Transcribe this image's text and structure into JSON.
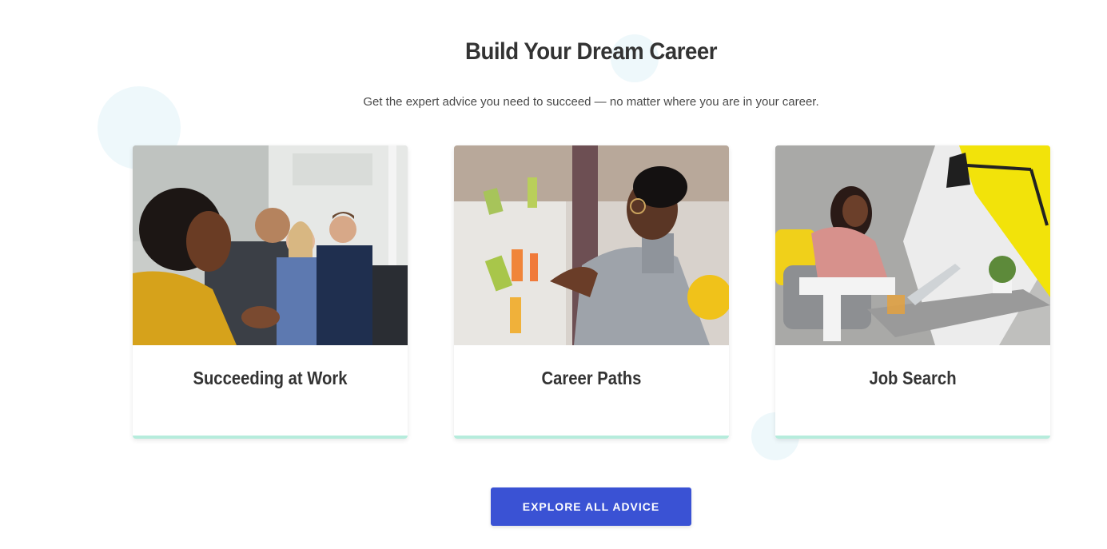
{
  "section": {
    "title": "Build Your Dream Career",
    "subtitle": "Get the expert advice you need to succeed — no matter where you are in your career."
  },
  "cards": [
    {
      "label": "Succeeding at Work",
      "image": "team-meeting-photo"
    },
    {
      "label": "Career Paths",
      "image": "woman-writing-on-glass-photo"
    },
    {
      "label": "Job Search",
      "image": "woman-on-laptop-photo"
    }
  ],
  "cta": {
    "label": "EXPLORE ALL ADVICE"
  },
  "colors": {
    "button": "#3a52d4",
    "card_accent": "#b6ecdc",
    "heading": "#333333",
    "bubble": "#eef8fb"
  }
}
